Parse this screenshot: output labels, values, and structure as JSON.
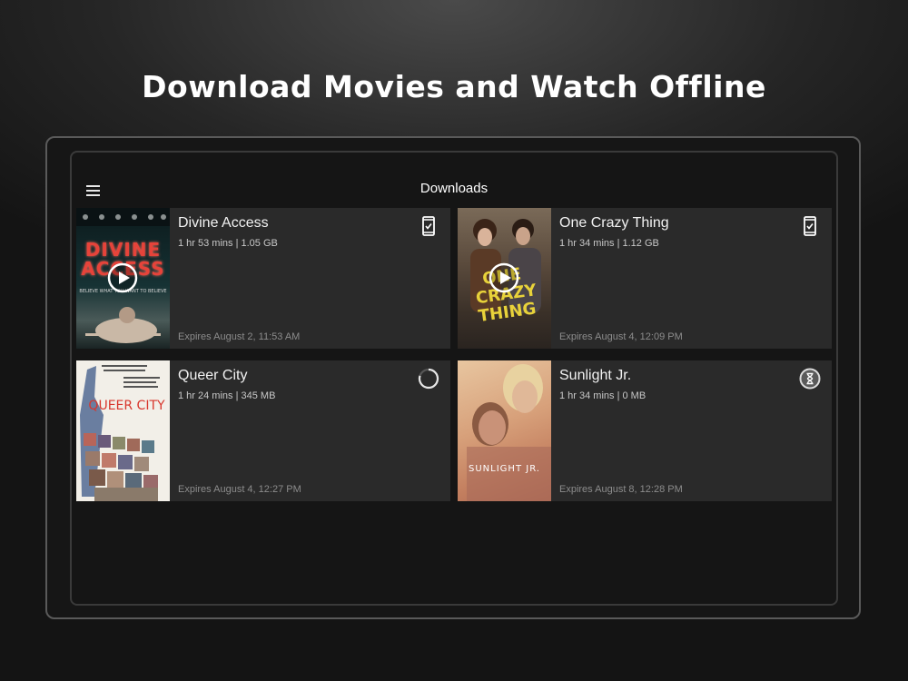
{
  "headline": "Download Movies and Watch Offline",
  "app": {
    "title": "Downloads"
  },
  "colors": {
    "background": "#1a1a1a",
    "card": "#2a2a2a",
    "text_primary": "#f2f2f2",
    "text_secondary": "#c8c8c8",
    "text_muted": "#8c8c8c"
  },
  "downloads": [
    {
      "title": "Divine Access",
      "meta": "1 hr 53 mins | 1.05 GB",
      "expires": "Expires August 2, 11:53 AM",
      "status": "downloaded",
      "status_icon": "phone-check-icon",
      "poster_text": "DIVINE ACCESS",
      "poster_tagline": "BELIEVE WHAT YOU WANT TO BELIEVE"
    },
    {
      "title": "One Crazy Thing",
      "meta": "1 hr 34 mins | 1.12 GB",
      "expires": "Expires August 4, 12:09 PM",
      "status": "downloaded",
      "status_icon": "phone-check-icon",
      "poster_text": "ONE CRAZY THING"
    },
    {
      "title": "Queer City",
      "meta": "1 hr 24 mins | 345 MB",
      "expires": "Expires August 4, 12:27 PM",
      "status": "downloading",
      "status_icon": "progress-spinner-icon",
      "poster_text": "QUEER CITY"
    },
    {
      "title": "Sunlight Jr.",
      "meta": "1 hr 34 mins | 0 MB",
      "expires": "Expires August 8, 12:28 PM",
      "status": "queued",
      "status_icon": "hourglass-icon",
      "poster_text": "SUNLIGHT JR."
    }
  ]
}
